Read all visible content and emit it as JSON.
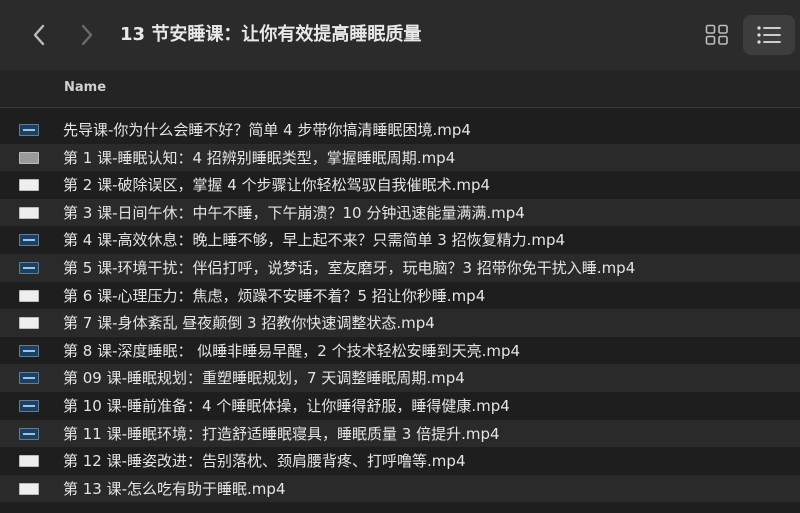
{
  "window": {
    "title": "13 节安睡课：让你有效提高睡眠质量"
  },
  "header": {
    "name_label": "Name"
  },
  "colors": {
    "toolbar_bg": "#2b2b2b",
    "list_bg": "#1e1e1e",
    "alt_row_bg": "#2a2a2a",
    "text": "#e4e4e4"
  },
  "files": [
    {
      "name": "先导课-你为什么会睡不好？简单 4 步带你搞清睡眠困境.mp4",
      "icon": "video-file-icon"
    },
    {
      "name": "第 1 课-睡眠认知：4 招辨别睡眠类型，掌握睡眠周期.mp4",
      "icon": "video-file-icon"
    },
    {
      "name": "第 2 课-破除误区，掌握 4 个步骤让你轻松驾驭自我催眠术.mp4",
      "icon": "video-file-icon"
    },
    {
      "name": "第 3 课-日间午休：中午不睡，下午崩溃？10 分钟迅速能量满满.mp4",
      "icon": "video-file-icon"
    },
    {
      "name": "第 4 课-高效休息：晚上睡不够，早上起不来？只需简单 3 招恢复精力.mp4",
      "icon": "video-file-icon"
    },
    {
      "name": "第 5 课-环境干扰：伴侣打呼，说梦话，室友磨牙，玩电脑？3 招带你免干扰入睡.mp4",
      "icon": "video-file-icon"
    },
    {
      "name": "第 6 课-心理压力：焦虑，烦躁不安睡不着？5 招让你秒睡.mp4",
      "icon": "video-file-icon"
    },
    {
      "name": "第 7 课-身体紊乱 昼夜颠倒 3 招教你快速调整状态.mp4",
      "icon": "video-file-icon"
    },
    {
      "name": "第 8 课-深度睡眠： 似睡非睡易早醒，2 个技术轻松安睡到天亮.mp4",
      "icon": "video-file-icon"
    },
    {
      "name": "第 09 课-睡眠规划：重塑睡眠规划，7 天调整睡眠周期.mp4",
      "icon": "video-file-icon"
    },
    {
      "name": "第 10 课-睡前准备：4 个睡眠体操，让你睡得舒服，睡得健康.mp4",
      "icon": "video-file-icon"
    },
    {
      "name": "第 11 课-睡眠环境：打造舒适睡眠寝具，睡眠质量 3 倍提升.mp4",
      "icon": "video-file-icon"
    },
    {
      "name": "第 12 课-睡姿改进：告别落枕、颈肩腰背疼、打呼噜等.mp4",
      "icon": "video-file-icon"
    },
    {
      "name": "第 13 课-怎么吃有助于睡眠.mp4",
      "icon": "video-file-icon"
    }
  ]
}
